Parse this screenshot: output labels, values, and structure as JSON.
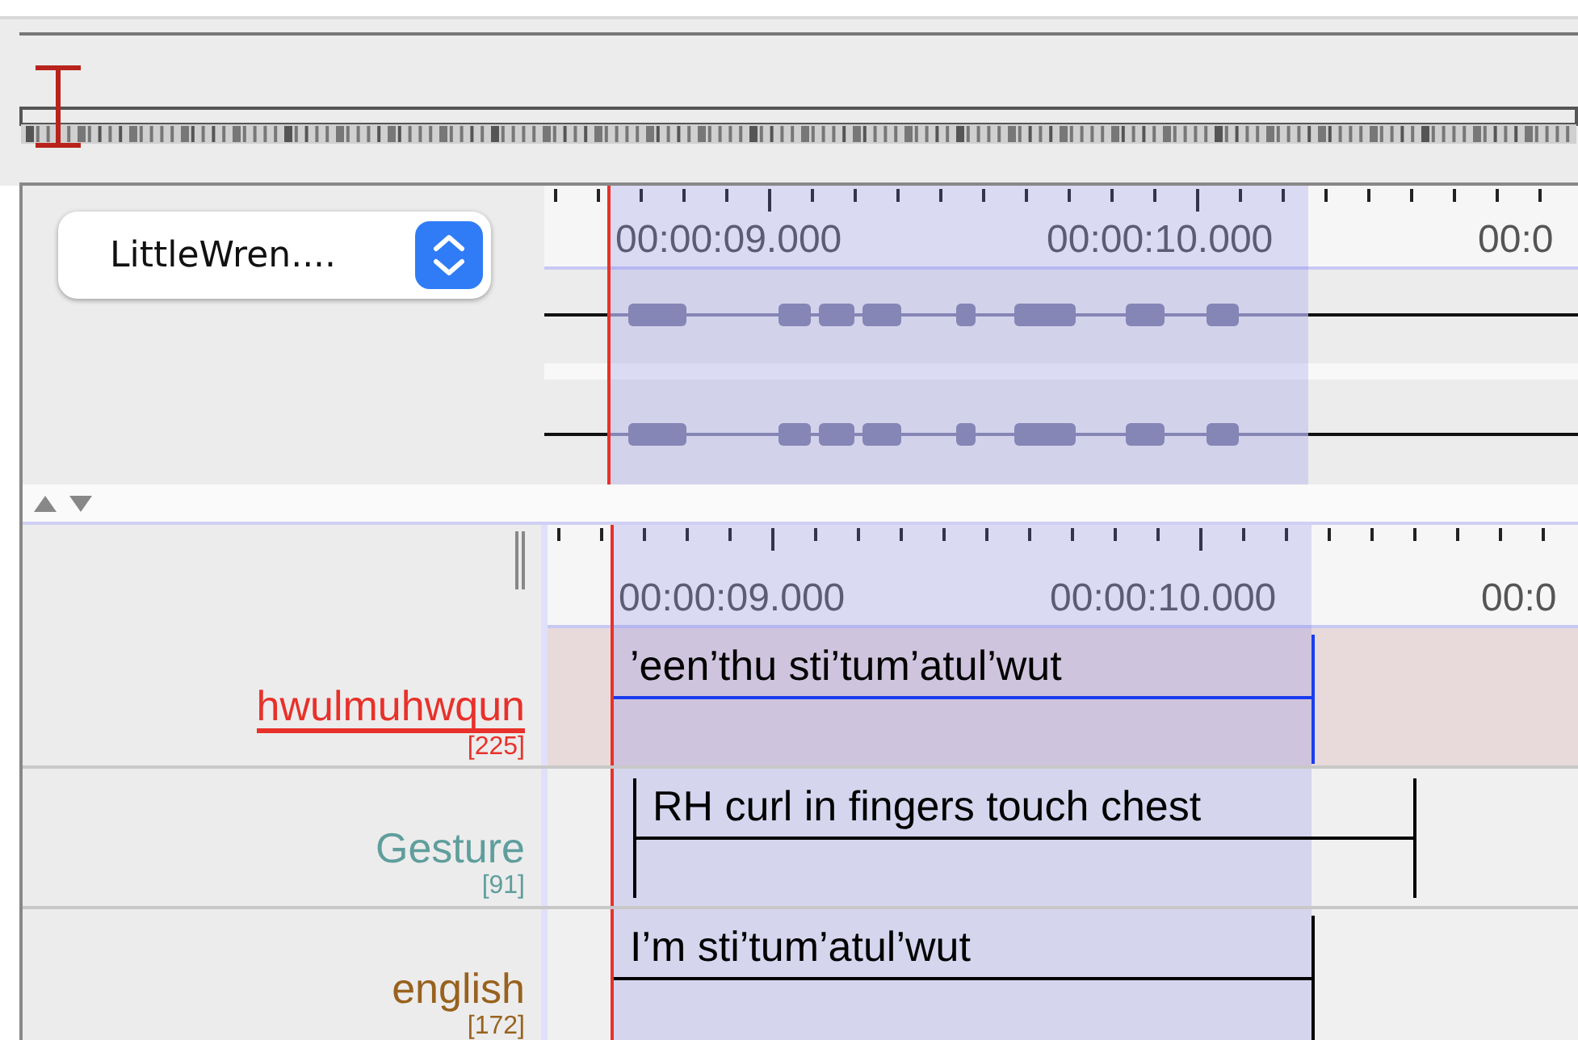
{
  "media_selector": {
    "value": "LittleWren...."
  },
  "upper_ruler": {
    "labels": [
      "00:00:09.000",
      "00:00:10.000",
      "00:0"
    ]
  },
  "lower_ruler": {
    "labels": [
      "00:00:09.000",
      "00:00:10.000",
      "00:0"
    ]
  },
  "tiers": [
    {
      "name": "hwulmuhwqun",
      "count": "[225]",
      "color": "#e8312a",
      "selected": true,
      "annotations": [
        {
          "text": "’een’thu sti’tum’atul’wut"
        }
      ]
    },
    {
      "name": "Gesture",
      "count": "[91]",
      "color": "#5f9e9c",
      "selected": false,
      "annotations": [
        {
          "text": "RH curl in fingers touch chest"
        }
      ]
    },
    {
      "name": "english",
      "count": "[172]",
      "color": "#98621e",
      "selected": false,
      "annotations": [
        {
          "text": "I’m sti’tum’atul’wut"
        }
      ]
    }
  ]
}
